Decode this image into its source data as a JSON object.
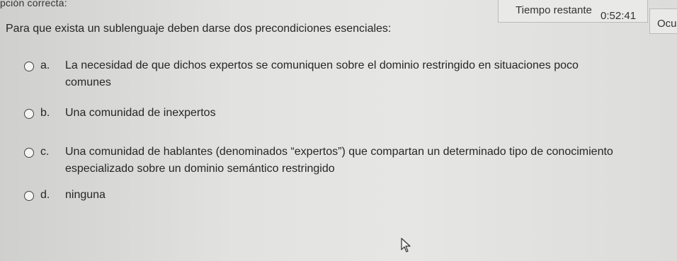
{
  "header": {
    "answer_label": "pción correcta:",
    "time_label": "Tiempo restante",
    "time_value": "0:52:41",
    "hide_label": "Ocu"
  },
  "question": {
    "text": "Para que exista un sublenguaje deben darse dos precondiciones esenciales:",
    "options": [
      {
        "letter": "a.",
        "line1": "La necesidad de que dichos expertos se comuniquen sobre el dominio restringido en situaciones poco",
        "line2": "comunes"
      },
      {
        "letter": "b.",
        "line1": "Una comunidad de inexpertos"
      },
      {
        "letter": "c.",
        "line1": "Una comunidad de hablantes (denominados “expertos”) que compartan un determinado tipo de conocimiento",
        "line2": "especializado sobre un dominio semántico restringido"
      },
      {
        "letter": "d.",
        "line1": "ninguna"
      }
    ]
  }
}
